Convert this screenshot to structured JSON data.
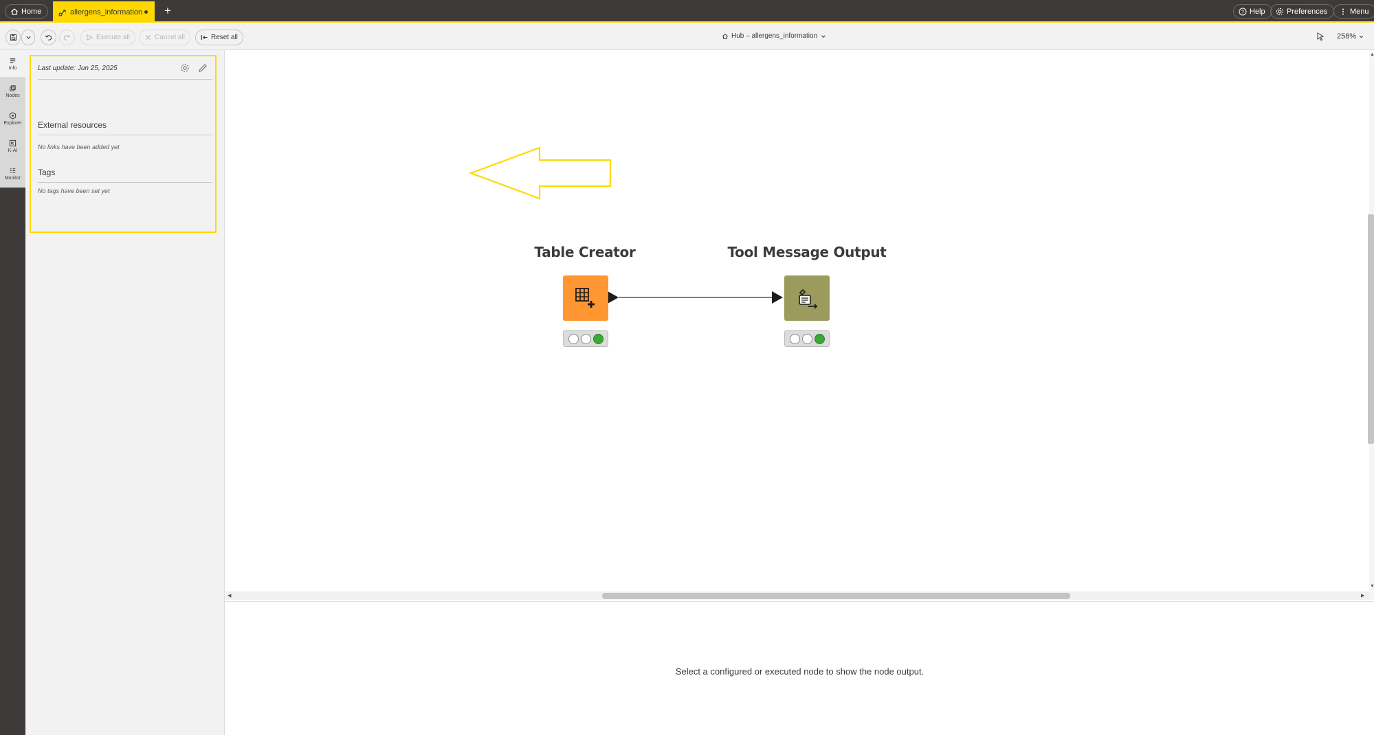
{
  "topbar": {
    "home_label": "Home",
    "tab_label": "allergens_information",
    "new_tab": "+",
    "help_label": "Help",
    "preferences_label": "Preferences",
    "menu_label": "Menu"
  },
  "toolbar": {
    "execute_all_label": "Execute all",
    "cancel_all_label": "Cancel all",
    "reset_all_label": "Reset all",
    "breadcrumb": "Hub – allergens_information",
    "zoom": "258%"
  },
  "rail": {
    "items": [
      {
        "label": "Info",
        "icon": "info-icon",
        "active": true
      },
      {
        "label": "Nodes",
        "icon": "nodes-icon",
        "active": false
      },
      {
        "label": "Explorer",
        "icon": "explorer-icon",
        "active": false
      },
      {
        "label": "K-AI",
        "icon": "k-ai-icon",
        "active": false
      },
      {
        "label": "Monitor",
        "icon": "monitor-icon",
        "active": false
      }
    ]
  },
  "info_panel": {
    "last_update": "Last update: Jun 25, 2025",
    "external_resources_title": "External resources",
    "external_resources_note": "No links have been added yet",
    "tags_title": "Tags",
    "tags_note": "No tags have been set yet"
  },
  "workflow": {
    "nodes": [
      {
        "title": "Table Creator",
        "color": "#ff9632",
        "icon": "table-creator-icon",
        "status": "executed"
      },
      {
        "title": "Tool Message Output",
        "color": "#9b9b5e",
        "icon": "tool-message-output-icon",
        "status": "executed"
      }
    ]
  },
  "colors": {
    "accent": "#ffd800",
    "dark": "#3e3a39",
    "status_green": "#3ba935"
  },
  "output": {
    "message": "Select a configured or executed node to show the node output."
  }
}
